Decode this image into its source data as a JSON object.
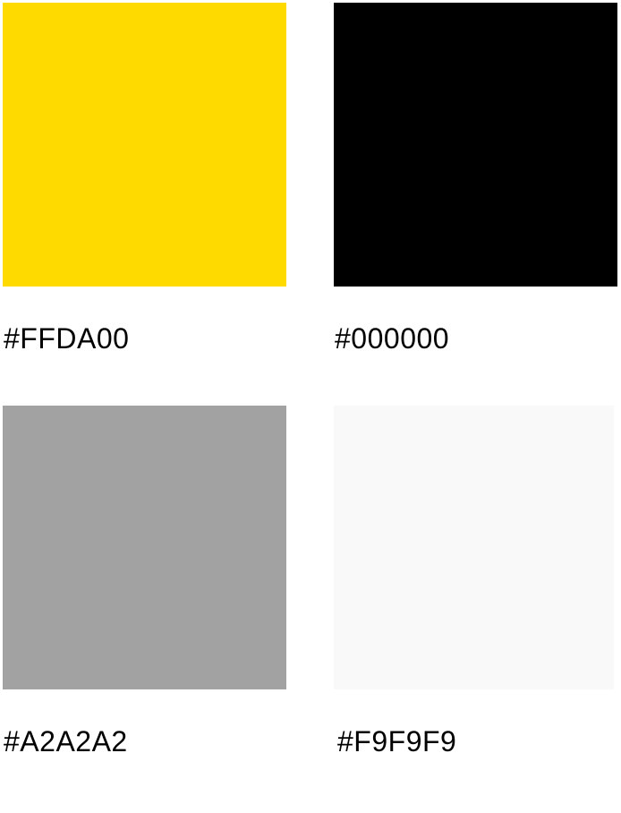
{
  "swatches": [
    {
      "label": "#FFDA00",
      "color": "#FFDA00"
    },
    {
      "label": "#000000",
      "color": "#000000"
    },
    {
      "label": "#A2A2A2",
      "color": "#A2A2A2"
    },
    {
      "label": "#F9F9F9",
      "color": "#F9F9F9"
    }
  ]
}
